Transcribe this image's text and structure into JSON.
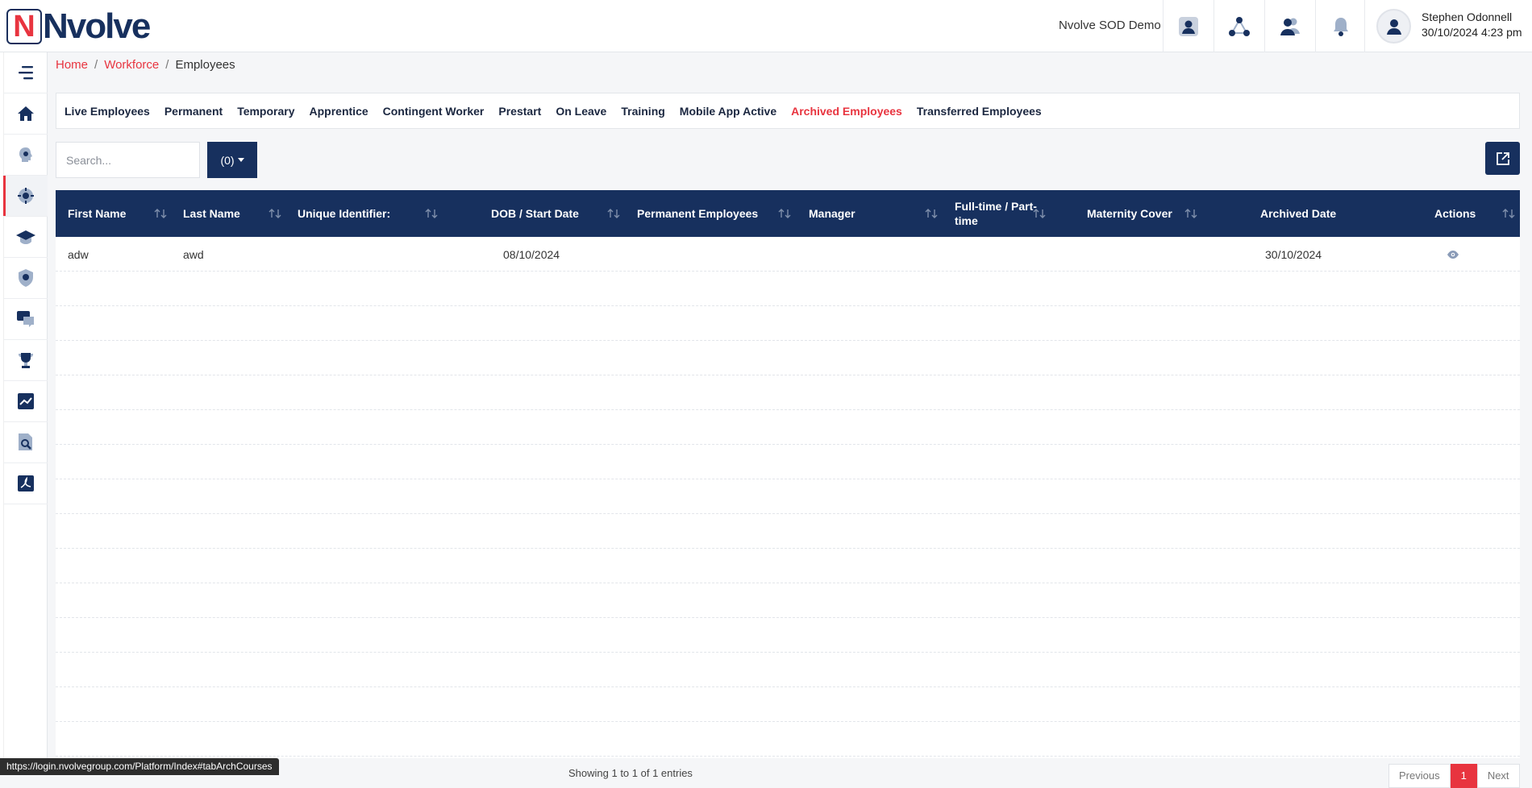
{
  "header": {
    "logo_letter": "N",
    "logo_text": "Nvolve",
    "company": "Nvolve SOD Demo",
    "user_name": "Stephen Odonnell",
    "user_datetime": "30/10/2024 4:23 pm",
    "icons": [
      "profile-card-icon",
      "org-network-icon",
      "users-icon",
      "bell-icon",
      "user-avatar-icon"
    ]
  },
  "sidebar": {
    "items": [
      "menu-toggle-icon",
      "home-icon",
      "employee-head-icon",
      "workforce-icon",
      "training-cap-icon",
      "shield-icon",
      "chat-icon",
      "trophy-icon",
      "chart-icon",
      "document-search-icon",
      "pdf-icon"
    ],
    "active_index": 3
  },
  "breadcrumb": {
    "home": "Home",
    "sep1": "/",
    "workforce": "Workforce",
    "sep2": "/",
    "current": "Employees"
  },
  "tabs": [
    {
      "label": "Live Employees"
    },
    {
      "label": "Permanent"
    },
    {
      "label": "Temporary"
    },
    {
      "label": "Apprentice"
    },
    {
      "label": "Contingent Worker"
    },
    {
      "label": "Prestart"
    },
    {
      "label": "On Leave"
    },
    {
      "label": "Training"
    },
    {
      "label": "Mobile App Active"
    },
    {
      "label": "Archived Employees",
      "active": true
    },
    {
      "label": "Transferred Employees"
    }
  ],
  "toolbar": {
    "search_placeholder": "Search...",
    "count_label": "(0)"
  },
  "table": {
    "columns": [
      "First Name",
      "Last Name",
      "Unique Identifier:",
      "DOB / Start Date",
      "Permanent Employees",
      "Manager",
      "Full-time / Part-time",
      "Maternity Cover",
      "Archived Date",
      "Actions"
    ],
    "rows": [
      {
        "first_name": "adw",
        "last_name": "awd",
        "unique_identifier": "",
        "dob_start": "08/10/2024",
        "permanent": "",
        "manager": "",
        "fulltime": "",
        "maternity": "",
        "archived_date": "30/10/2024",
        "action_icon": "eye-icon"
      }
    ]
  },
  "footer": {
    "status_url": "https://login.nvolvegroup.com/Platform/Index#tabArchCourses",
    "info": "Showing 1 to 1 of 1 entries",
    "prev": "Previous",
    "page": "1",
    "next": "Next"
  },
  "colors": {
    "brand_navy": "#17305e",
    "accent_red": "#e8343f"
  }
}
